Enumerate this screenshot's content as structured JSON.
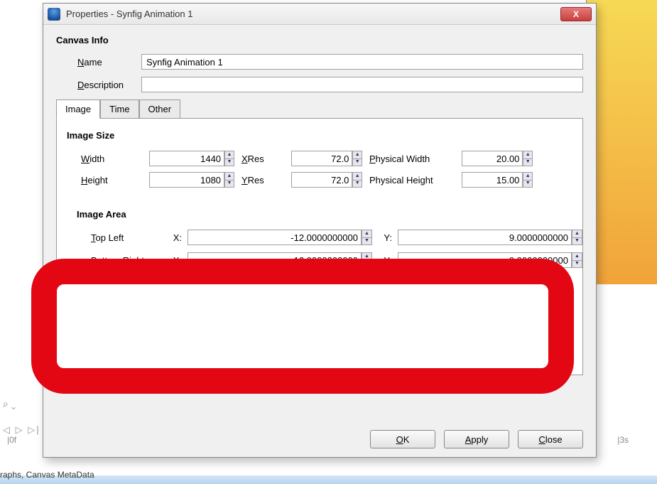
{
  "window": {
    "title": "Properties - Synfig Animation 1",
    "close_glyph": "X"
  },
  "section_canvas_info": "Canvas Info",
  "fields": {
    "name_label_pre": "",
    "name_underline": "N",
    "name_label_post": "ame",
    "name_value": "Synfig Animation 1",
    "desc_underline": "D",
    "desc_label_post": "escription",
    "desc_value": ""
  },
  "tabs": {
    "image": "Image",
    "time": "Time",
    "other": "Other"
  },
  "imagesize": {
    "title": "Image Size",
    "width_u": "W",
    "width_post": "idth",
    "width_val": "1440",
    "height_u": "H",
    "height_post": "eight",
    "height_val": "1080",
    "xres_u": "X",
    "xres_post": "Res",
    "xres_val": "72.0",
    "yres_u": "Y",
    "yres_post": "Res",
    "yres_val": "72.0",
    "pw_u": "P",
    "pw_post": "hysical Width",
    "pw_val": "20.00",
    "ph_label": "Physical Height",
    "ph_val": "15.00"
  },
  "imagearea": {
    "title": "Image Area",
    "tl_u": "T",
    "tl_post": "op Left",
    "br_u": "B",
    "br_post": "ottom Right",
    "x_label": "X:",
    "y_label": "Y:",
    "tl_x": "-12.0000000000",
    "tl_y": "9.0000000000",
    "br_x": "12.0000000000",
    "br_y": "-9.0000000000"
  },
  "buttons": {
    "ok_u": "O",
    "ok_post": "K",
    "apply_u": "A",
    "apply_post": "pply",
    "close_u": "C",
    "close_post": "lose"
  },
  "bg": {
    "footer": "raphs, Canvas MetaData",
    "time3s": "|3s",
    "time0": "|0f",
    "search": "⌕ ⌄",
    "playback": "◁ ▷ ▷|"
  }
}
